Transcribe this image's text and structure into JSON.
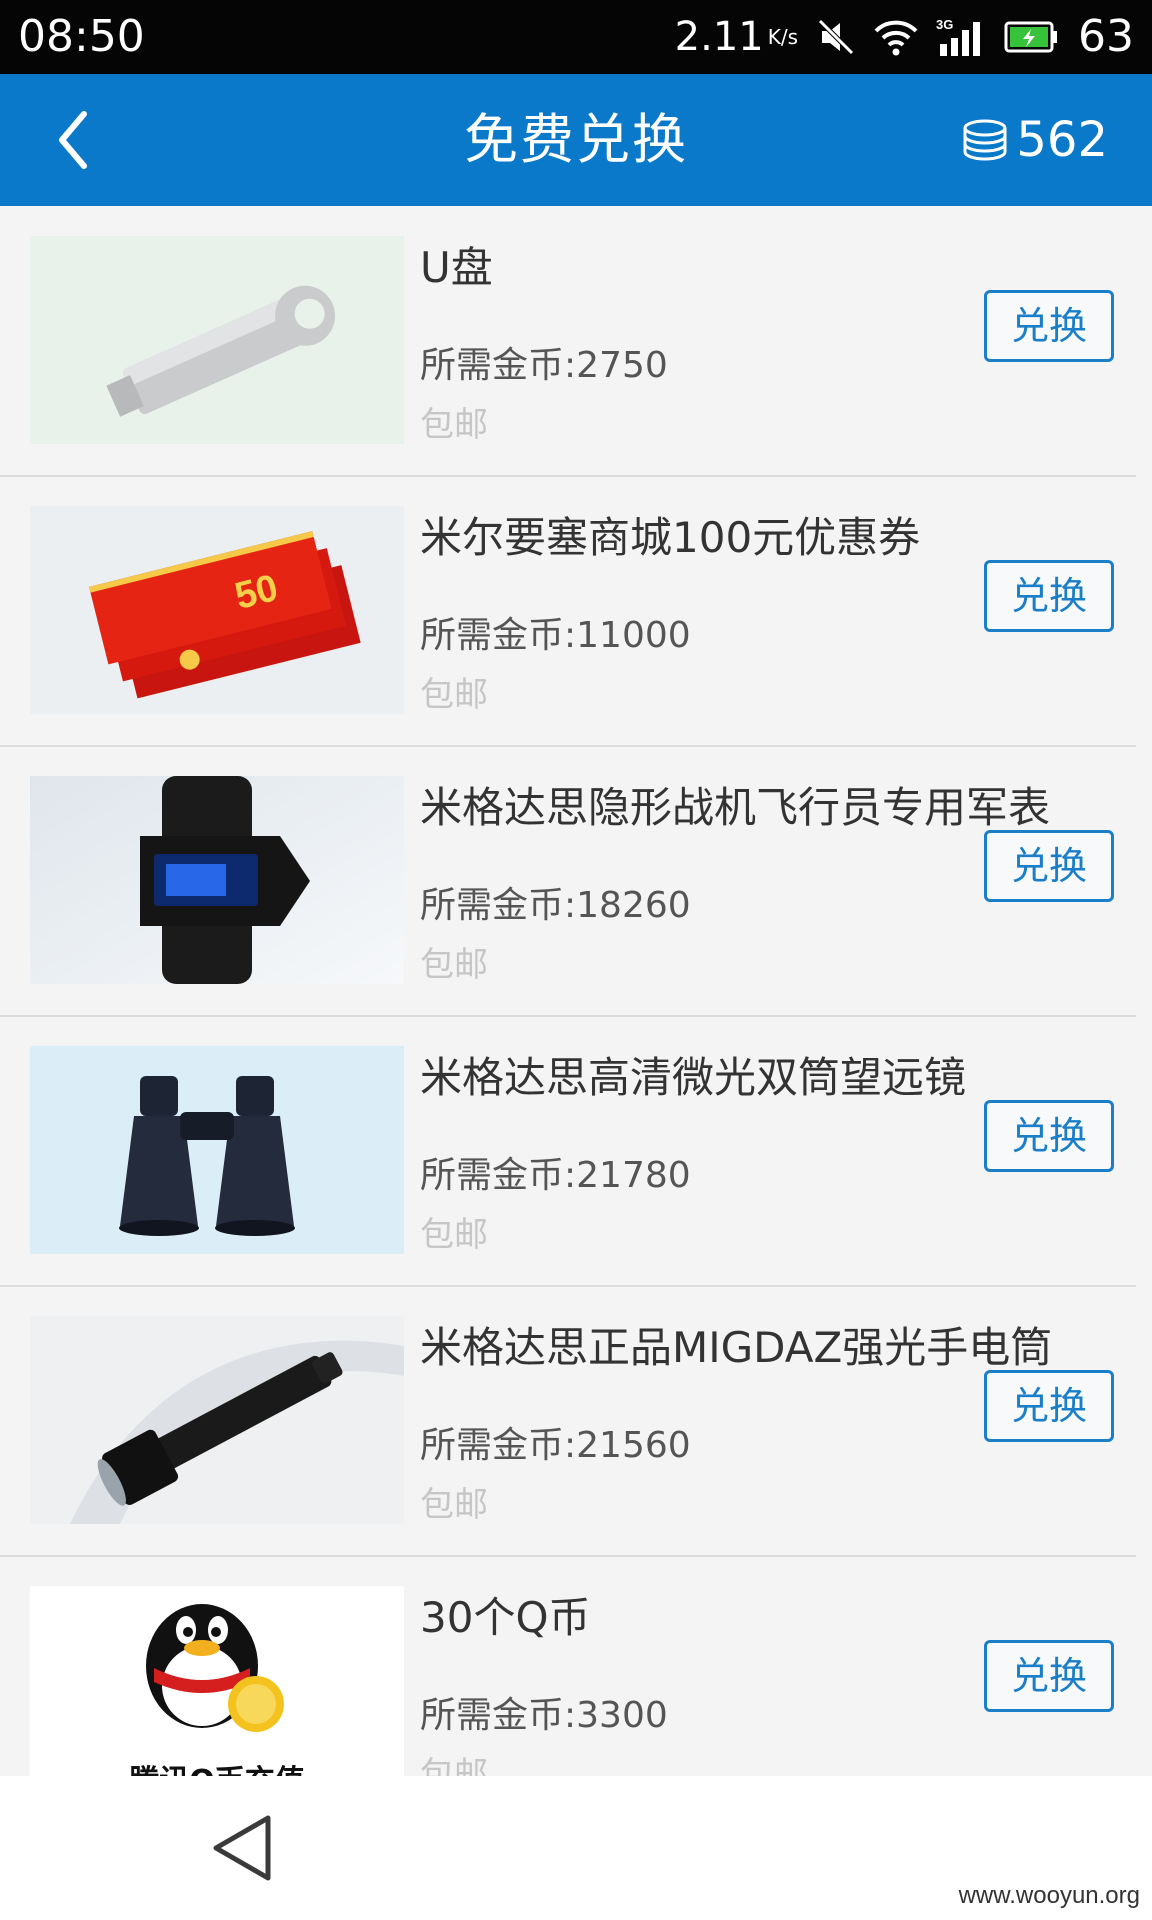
{
  "status_bar": {
    "time": "08:50",
    "speed": "2.11",
    "speed_unit": "K/s",
    "network": "3G",
    "battery": "63"
  },
  "app_bar": {
    "title": "免费兑换",
    "coins": "562"
  },
  "items": [
    {
      "name": "U盘",
      "cost": "所需金币:2750",
      "shipping": "包邮",
      "button": "兑换"
    },
    {
      "name": "米尔要塞商城100元优惠券",
      "cost": "所需金币:11000",
      "shipping": "包邮",
      "button": "兑换"
    },
    {
      "name": "米格达思隐形战机飞行员专用军表",
      "cost": "所需金币:18260",
      "shipping": "包邮",
      "button": "兑换"
    },
    {
      "name": "米格达思高清微光双筒望远镜",
      "cost": "所需金币:21780",
      "shipping": "包邮",
      "button": "兑换"
    },
    {
      "name": "米格达思正品MIGDAZ强光手电筒",
      "cost": "所需金币:21560",
      "shipping": "包邮",
      "button": "兑换"
    },
    {
      "name": "30个Q币",
      "cost": "所需金币:3300",
      "shipping": "包邮",
      "button": "兑换"
    }
  ],
  "images": {
    "voucher_label": "50",
    "qq_caption": "腾讯Q币充值"
  },
  "watermark": "www.wooyun.org",
  "colors": {
    "app_bar": "#0a79c9",
    "button_border": "#1a7ec8",
    "status_bar": "#050505"
  }
}
